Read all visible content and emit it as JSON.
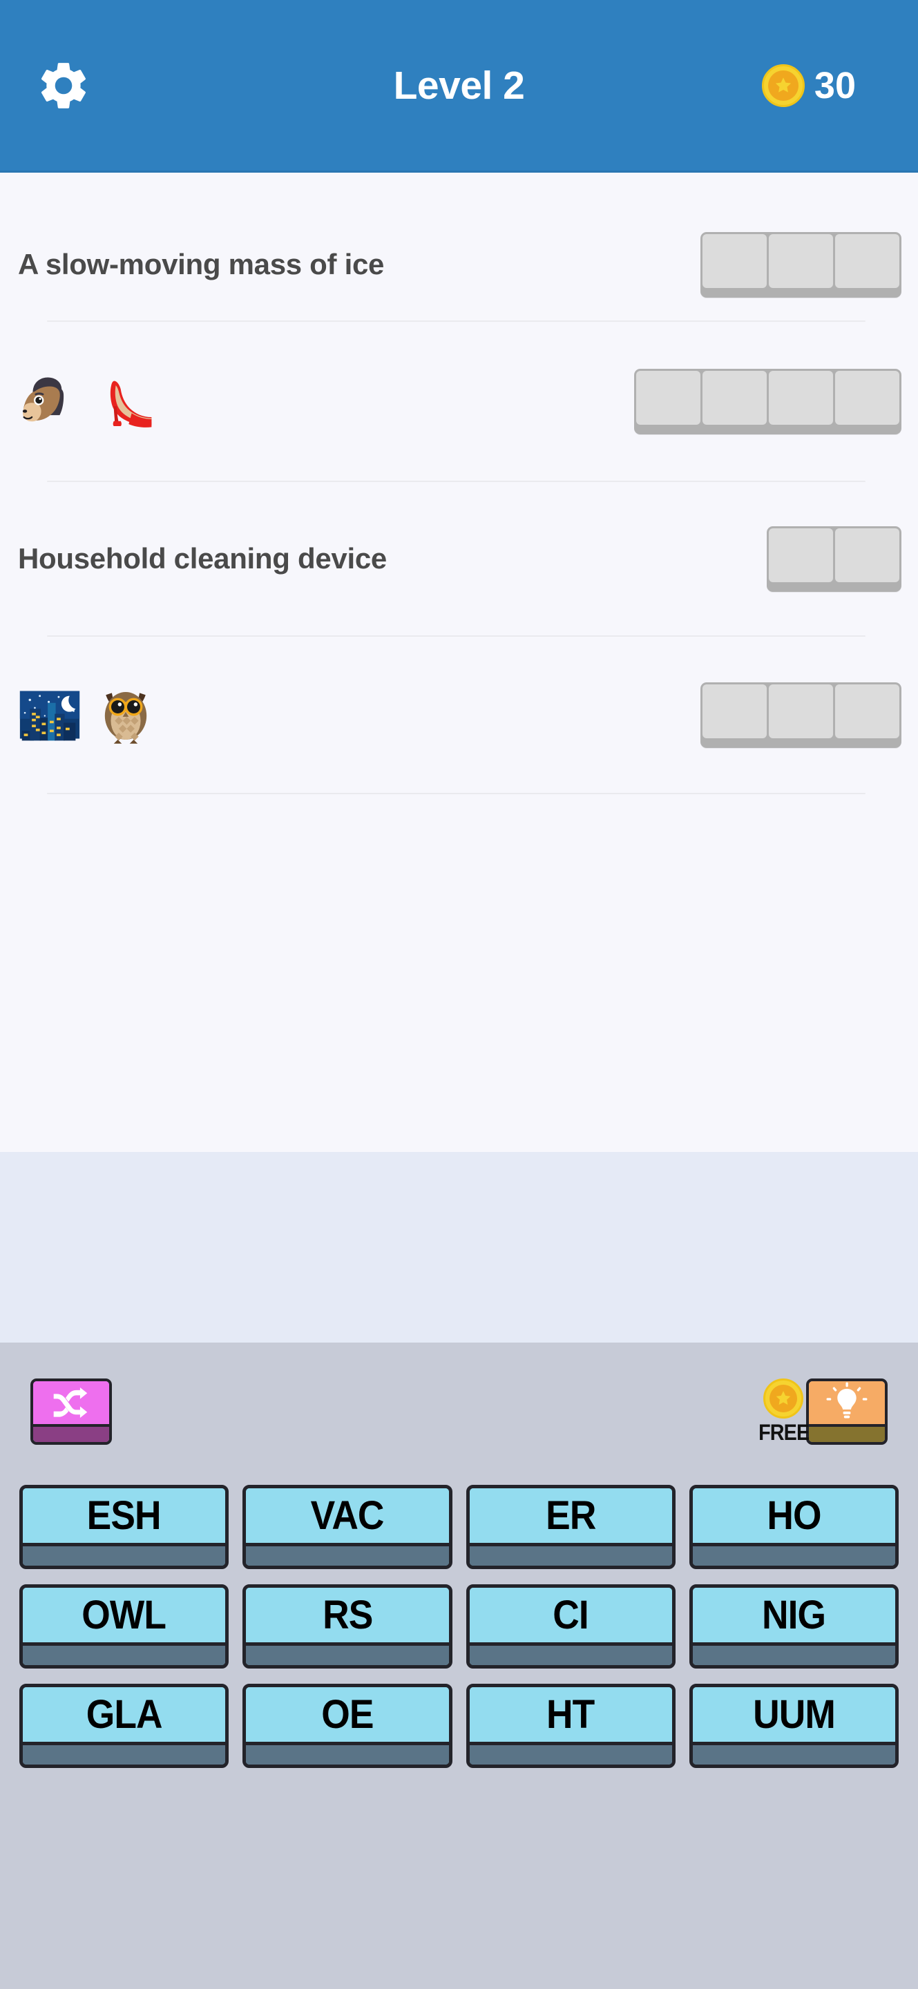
{
  "header": {
    "settings_icon": "gear-icon",
    "title": "Level 2",
    "coin_icon": "coin-star-icon",
    "coin_count": "30",
    "background_color": "#2f80bf",
    "title_color": "#ffffff"
  },
  "puzzle": {
    "background_color": "#f7f7fc",
    "clue_text_color": "#4a4a4a",
    "slot_fill_color": "#dcdcdc",
    "slot_base_color": "#b0b0b0",
    "rows": [
      {
        "clue_type": "text",
        "clue_text": "A slow-moving mass of ice",
        "emojis": [],
        "slot_count": 3
      },
      {
        "clue_type": "emoji",
        "clue_text": "",
        "emojis": [
          "horse-face-emoji",
          "high-heeled-shoe-emoji"
        ],
        "slot_count": 4
      },
      {
        "clue_type": "text",
        "clue_text": "Household cleaning device",
        "emojis": [],
        "slot_count": 2
      },
      {
        "clue_type": "emoji",
        "clue_text": "",
        "emojis": [
          "night-with-stars-emoji",
          "owl-emoji"
        ],
        "slot_count": 3
      }
    ]
  },
  "gap_band": {
    "background_color": "#e5eaf6"
  },
  "keyboard": {
    "background_color": "#c7cbd7",
    "tools": {
      "shuffle": {
        "icon": "shuffle-icon",
        "face_color": "#ee6fee",
        "base_color": "#8a3f84"
      },
      "hint": {
        "icon": "lightbulb-icon",
        "face_color": "#f6ab65",
        "base_color": "#85732f",
        "free_label": "FREE",
        "coin_icon": "coin-star-icon"
      }
    },
    "tile_face_color": "#93dcef",
    "tile_base_color": "#5a7487",
    "tile_border_color": "#23232a",
    "tile_rows": [
      [
        "ESH",
        "VAC",
        "ER",
        "HO"
      ],
      [
        "OWL",
        "RS",
        "CI",
        "NIG"
      ],
      [
        "GLA",
        "OE",
        "HT",
        "UUM"
      ]
    ]
  }
}
